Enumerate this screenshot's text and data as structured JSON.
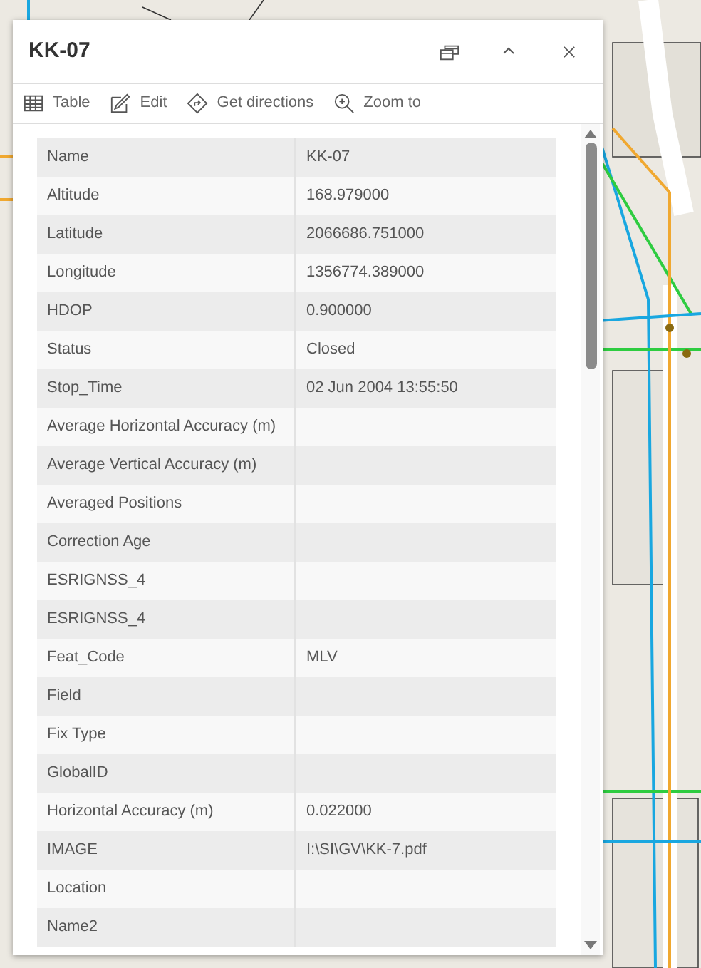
{
  "popup": {
    "title": "KK-07"
  },
  "toolbar": [
    {
      "kind": "table",
      "label": "Table"
    },
    {
      "kind": "edit",
      "label": "Edit"
    },
    {
      "kind": "directions",
      "label": "Get directions"
    },
    {
      "kind": "zoom",
      "label": "Zoom to"
    }
  ],
  "attributes": [
    {
      "field": "Name",
      "value": "KK-07"
    },
    {
      "field": "Altitude",
      "value": "168.979000"
    },
    {
      "field": "Latitude",
      "value": "2066686.751000"
    },
    {
      "field": "Longitude",
      "value": "1356774.389000"
    },
    {
      "field": "HDOP",
      "value": "0.900000"
    },
    {
      "field": "Status",
      "value": "Closed"
    },
    {
      "field": "Stop_Time",
      "value": "02 Jun 2004 13:55:50"
    },
    {
      "field": "Average Horizontal Accuracy (m)"
    },
    {
      "field": "Average Vertical Accuracy (m)"
    },
    {
      "field": "Averaged Positions"
    },
    {
      "field": "Correction Age"
    },
    {
      "field": "ESRIGNSS_4"
    },
    {
      "field": "ESRIGNSS_4"
    },
    {
      "field": "Feat_Code",
      "value": "MLV"
    },
    {
      "field": "Field"
    },
    {
      "field": "Fix Type"
    },
    {
      "field": "GlobalID"
    },
    {
      "field": "Horizontal Accuracy (m)",
      "value": "0.022000"
    },
    {
      "field": "IMAGE",
      "value": "I:\\SI\\GV\\KK-7.pdf"
    },
    {
      "field": "Location"
    },
    {
      "field": "Name2"
    }
  ]
}
